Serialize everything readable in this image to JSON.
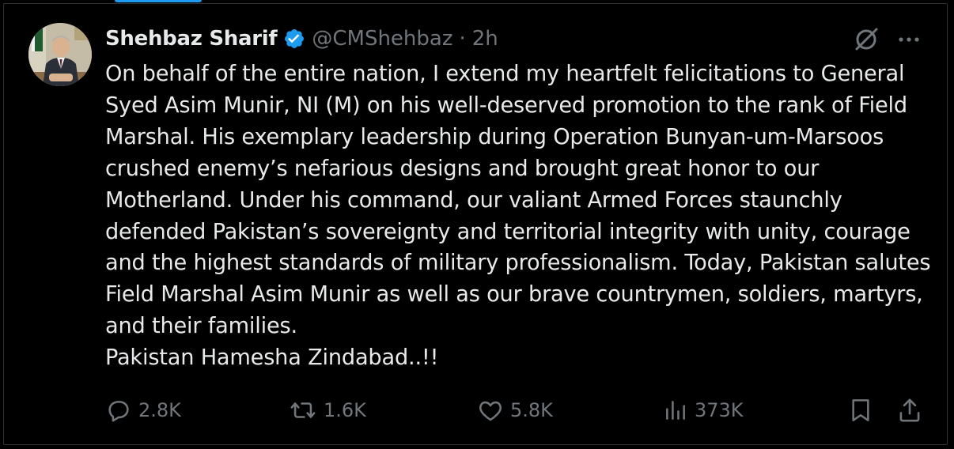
{
  "author": {
    "name": "Shehbaz Sharif",
    "handle": "@CMShehbaz",
    "separator": "·",
    "time": "2h",
    "verified_icon": "verified-badge-icon",
    "avatar_icon": "profile-photo"
  },
  "tweet": {
    "text_paragraphs": [
      "On behalf of the entire nation, I extend my heartfelt felicitations to General Syed Asim Munir, NI (M) on his well-deserved promotion to the rank of Field Marshal. His exemplary leadership during Operation Bunyan-um-Marsoos crushed enemy’s nefarious designs and brought great honor to our Motherland. Under his command, our valiant Armed Forces staunchly defended Pakistan’s sovereignty and territorial integrity with unity, courage and the highest standards of military professionalism. Today, Pakistan salutes Field Marshal Asim Munir as well as our brave countrymen, soldiers, martyrs, and their families.",
      "Pakistan Hamesha Zindabad..!!"
    ]
  },
  "actions": {
    "replies": "2.8K",
    "reposts": "1.6K",
    "likes": "5.8K",
    "views": "373K"
  },
  "icons": {
    "grok": "grok-icon",
    "more": "more-icon",
    "reply": "reply-icon",
    "repost": "repost-icon",
    "like": "heart-icon",
    "views": "views-icon",
    "bookmark": "bookmark-icon",
    "share": "share-icon"
  },
  "colors": {
    "background": "#000000",
    "text": "#e7e9ea",
    "secondary_text": "#71767b",
    "verified": "#1d9bf0",
    "border": "#2f3336"
  }
}
